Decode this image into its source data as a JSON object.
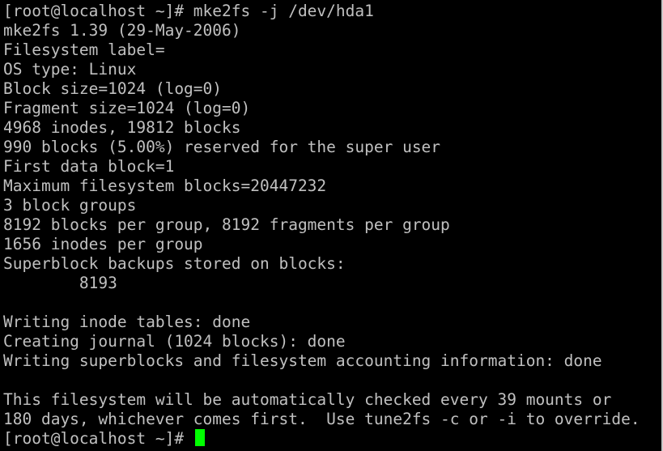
{
  "terminal": {
    "lines": [
      "[root@localhost ~]# mke2fs -j /dev/hda1",
      "mke2fs 1.39 (29-May-2006)",
      "Filesystem label=",
      "OS type: Linux",
      "Block size=1024 (log=0)",
      "Fragment size=1024 (log=0)",
      "4968 inodes, 19812 blocks",
      "990 blocks (5.00%) reserved for the super user",
      "First data block=1",
      "Maximum filesystem blocks=20447232",
      "3 block groups",
      "8192 blocks per group, 8192 fragments per group",
      "1656 inodes per group",
      "Superblock backups stored on blocks:",
      "        8193",
      "",
      "Writing inode tables: done",
      "Creating journal (1024 blocks): done",
      "Writing superblocks and filesystem accounting information: done",
      "",
      "This filesystem will be automatically checked every 39 mounts or",
      "180 days, whichever comes first.  Use tune2fs -c or -i to override."
    ],
    "prompt": "[root@localhost ~]# ",
    "colors": {
      "background": "#000000",
      "foreground": "#c0c0c0",
      "cursor": "#00ff00"
    }
  }
}
